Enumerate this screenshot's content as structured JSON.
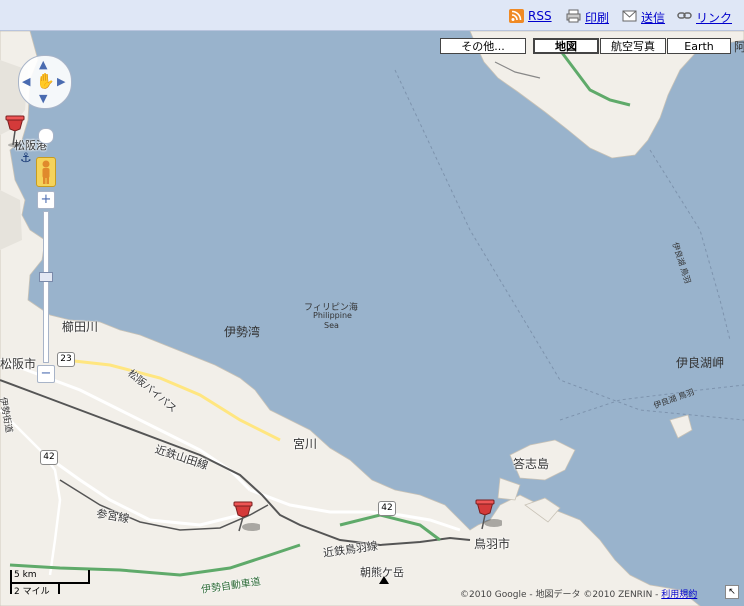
{
  "toolbar": {
    "rss": "RSS",
    "print": "印刷",
    "send": "送信",
    "link": "リンク",
    "cut_char": "阿"
  },
  "map_types": {
    "more": "その他...",
    "map": "地図",
    "satellite": "航空写真",
    "earth": "Earth",
    "selected": "地図"
  },
  "labels": {
    "matsusaka_port": "松阪港",
    "kushidagawa": "櫛田川",
    "matsusaka_city": "松阪市",
    "ise_bay": "伊勢湾",
    "sea_jp": "フィリピン海",
    "sea_en1": "Philippine",
    "sea_en2": "Sea",
    "irago_cape": "伊良湖岬",
    "irago_route1": "伊良湖 鳥羽",
    "irago_route2": "伊良湖 鳥羽",
    "miyagawa": "宮川",
    "kintetsu_yamada": "近鉄山田線",
    "sangu_line": "参宮線",
    "toshijima": "答志島",
    "toba_city": "鳥羽市",
    "kintetsu_toba": "近鉄鳥羽線",
    "asamagatake": "朝熊ケ岳",
    "ise_expressway": "伊勢自動車道",
    "bypass": "松阪バイパス",
    "vertical_road": "伊勢街道",
    "route_23": "23",
    "route_42a": "42",
    "route_42b": "42"
  },
  "scale": {
    "km": "5 km",
    "mi": "2 マイル"
  },
  "copyright": {
    "text": "©2010 Google - 地図データ ©2010 ZENRIN - ",
    "terms": "利用規約"
  },
  "colors": {
    "sea": "#99b3cc",
    "land": "#f2efe9",
    "highway": "#5faa6a",
    "rail": "#555555",
    "road_major": "#ffe680"
  },
  "markers": [
    {
      "name": "marker-matsusaka"
    },
    {
      "name": "marker-ise"
    },
    {
      "name": "marker-toba"
    }
  ]
}
